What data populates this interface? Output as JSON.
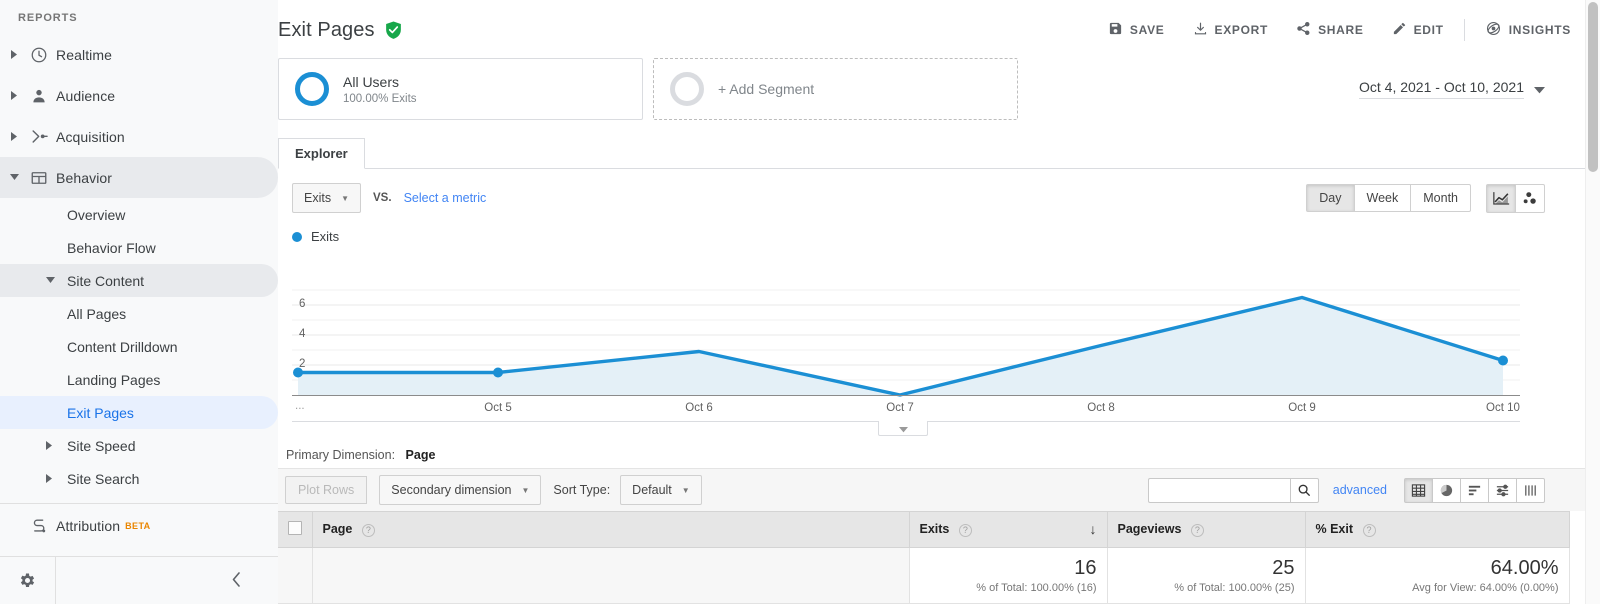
{
  "sidebar": {
    "heading": "REPORTS",
    "items": [
      {
        "label": "Realtime",
        "icon": "clock-icon"
      },
      {
        "label": "Audience",
        "icon": "person-icon"
      },
      {
        "label": "Acquisition",
        "icon": "acquisition-icon"
      },
      {
        "label": "Behavior",
        "icon": "behavior-icon"
      }
    ],
    "behavior_children": [
      {
        "label": "Overview"
      },
      {
        "label": "Behavior Flow"
      }
    ],
    "site_content": {
      "label": "Site Content"
    },
    "site_content_children": [
      {
        "label": "All Pages"
      },
      {
        "label": "Content Drilldown"
      },
      {
        "label": "Landing Pages"
      },
      {
        "label": "Exit Pages"
      }
    ],
    "collapsed_groups": [
      {
        "label": "Site Speed"
      },
      {
        "label": "Site Search"
      }
    ],
    "attribution": {
      "label": "Attribution",
      "badge": "BETA",
      "icon": "attribution-icon"
    },
    "footer": {
      "settings_icon": "gear-icon",
      "collapse_icon": "chevron-left-icon"
    }
  },
  "header": {
    "title": "Exit Pages",
    "verified_icon": "shield-check-icon",
    "actions": [
      {
        "label": "SAVE",
        "icon": "save-icon"
      },
      {
        "label": "EXPORT",
        "icon": "download-icon"
      },
      {
        "label": "SHARE",
        "icon": "share-icon"
      },
      {
        "label": "EDIT",
        "icon": "pencil-icon"
      },
      {
        "label": "INSIGHTS",
        "icon": "insights-icon"
      }
    ]
  },
  "segments": {
    "applied": {
      "name": "All Users",
      "sub": "100.00% Exits"
    },
    "add": {
      "label": "+ Add Segment"
    }
  },
  "daterange": {
    "value": "Oct 4, 2021 - Oct 10, 2021",
    "caret_icon": "chevron-down-icon"
  },
  "tabs": [
    {
      "label": "Explorer",
      "active": true
    }
  ],
  "metric_controls": {
    "primary_metric": "Exits",
    "vs_label": "VS.",
    "select_metric": "Select a metric",
    "granularity": [
      {
        "label": "Day",
        "active": true
      },
      {
        "label": "Week",
        "active": false
      },
      {
        "label": "Month",
        "active": false
      }
    ],
    "chart_modes": [
      {
        "icon": "line-chart-icon",
        "active": true
      },
      {
        "icon": "motion-chart-icon",
        "active": false
      }
    ]
  },
  "chart_data": {
    "type": "area",
    "title": "",
    "legend": [
      "Exits"
    ],
    "legend_position": "top-left",
    "series": [
      {
        "name": "Exits",
        "values": [
          1.5,
          1.5,
          2.9,
          0,
          3.3,
          6.5,
          2.3
        ]
      }
    ],
    "categories": [
      "",
      "Oct 5",
      "Oct 6",
      "Oct 7",
      "Oct 8",
      "Oct 9",
      "Oct 10"
    ],
    "x_first_label": "...",
    "xlabel": "",
    "ylabel": "",
    "ylim": [
      0,
      7
    ],
    "yticks": [
      2,
      4,
      6
    ],
    "grid": true,
    "line_color": "#1b8fd4",
    "fill_color": "#e4f0f7"
  },
  "chart_collapse": {
    "icon": "chevron-down-icon"
  },
  "primary_dimension": {
    "label": "Primary Dimension:",
    "value": "Page"
  },
  "table_toolbar": {
    "plot_rows": "Plot Rows",
    "secondary_dimension": "Secondary dimension",
    "sort_type_label": "Sort Type:",
    "sort_type_value": "Default",
    "search_placeholder": "",
    "search_value": "",
    "search_icon": "search-icon",
    "advanced": "advanced",
    "view_icons": [
      {
        "icon": "table-view-icon",
        "active": true
      },
      {
        "icon": "pie-view-icon",
        "active": false
      },
      {
        "icon": "performance-view-icon",
        "active": false
      },
      {
        "icon": "comparison-view-icon",
        "active": false
      },
      {
        "icon": "pivot-view-icon",
        "active": false
      }
    ]
  },
  "table": {
    "columns": [
      {
        "label": "Page",
        "help": "?",
        "sorted": false
      },
      {
        "label": "Exits",
        "help": "?",
        "sorted": true,
        "sort_icon": "arrow-down-icon"
      },
      {
        "label": "Pageviews",
        "help": "?",
        "sorted": false
      },
      {
        "label": "% Exit",
        "help": "?",
        "sorted": false
      }
    ],
    "totals_row": {
      "exits": {
        "value": "16",
        "sub": "% of Total: 100.00% (16)"
      },
      "pageviews": {
        "value": "25",
        "sub": "% of Total: 100.00% (25)"
      },
      "exit_rate": {
        "value": "64.00%",
        "sub": "Avg for View: 64.00% (0.00%)"
      }
    }
  },
  "colors": {
    "accent": "#1a73e8",
    "chart_line": "#1b8fd4",
    "verified_green": "#17a74a",
    "beta_orange": "#ea8600"
  }
}
